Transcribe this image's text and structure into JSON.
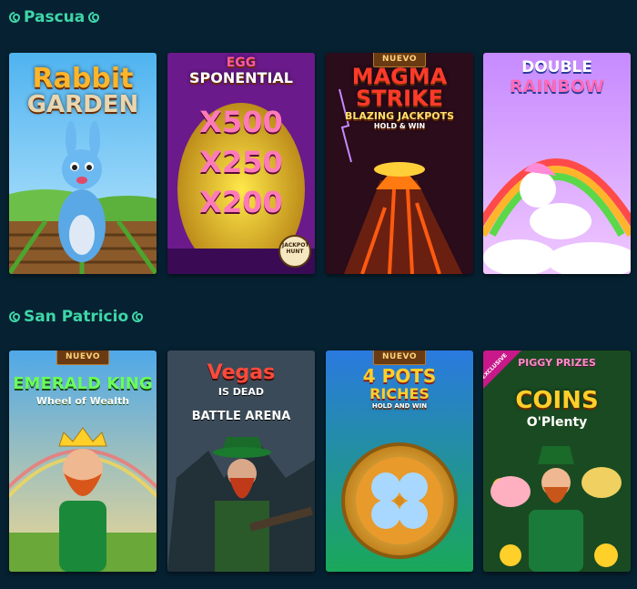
{
  "sections": [
    {
      "title": "Pascua",
      "games": [
        {
          "title_line1": "Rabbit",
          "title_line2": "GARDEN",
          "badge": ""
        },
        {
          "title_line1": "EGG",
          "title_line2": "SPONENTIAL",
          "multipliers": [
            "X500",
            "X250",
            "X200"
          ],
          "provider": "JACKPOT HUNT"
        },
        {
          "title_line1": "MAGMA",
          "title_line2": "STRIKE",
          "subtitle": "BLAZING JACKPOTS",
          "tag": "HOLD & WIN",
          "badge": "NUEVO"
        },
        {
          "title_line1": "DOUBLE",
          "title_line2": "RAINBOW"
        }
      ]
    },
    {
      "title": "San Patricio",
      "games": [
        {
          "title_line1": "EMERALD KING",
          "subtitle": "Wheel of Wealth",
          "badge": "NUEVO"
        },
        {
          "title_line1": "Vegas",
          "title_line2": "IS DEAD",
          "subtitle": "BATTLE ARENA"
        },
        {
          "title_line1": "4 POTS",
          "title_line2": "RICHES",
          "tag": "HOLD AND WIN",
          "badge": "NUEVO"
        },
        {
          "title_line1": "PIGGY PRIZES",
          "title_line2": "COINS",
          "subtitle": "O'Plenty",
          "ribbon": "EXCLUSIVE"
        }
      ]
    }
  ],
  "colors": {
    "background": "#062232",
    "section_title": "#3fd6a8",
    "badge_bg": "#6a3a12",
    "badge_text": "#ffd27a"
  }
}
